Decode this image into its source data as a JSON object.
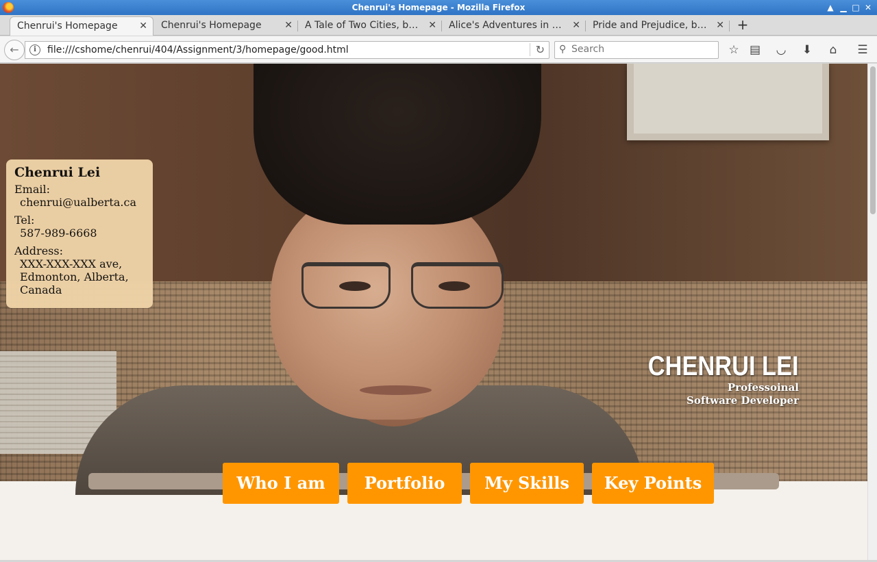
{
  "window": {
    "title": "Chenrui's Homepage - Mozilla Firefox"
  },
  "tabs": [
    {
      "label": "Chenrui's Homepage"
    },
    {
      "label": "Chenrui's Homepage"
    },
    {
      "label": "A Tale of Two Cities, by ..."
    },
    {
      "label": "Alice's Adventures in W..."
    },
    {
      "label": "Pride and Prejudice, by J..."
    }
  ],
  "navbar": {
    "url": "file:///cshome/chenrui/404/Assignment/3/homepage/good.html",
    "search_placeholder": "Search"
  },
  "page": {
    "contact": {
      "name": "Chenrui Lei",
      "email_label": "Email:",
      "email": "chenrui@ualberta.ca",
      "tel_label": "Tel:",
      "tel": "587-989-6668",
      "address_label": "Address:",
      "address_line1": "XXX-XXX-XXX ave,",
      "address_line2": "Edmonton, Alberta,",
      "address_line3": "Canada"
    },
    "hero": {
      "name": "CHENRUI LEI",
      "subtitle": "Professoinal Software Developer"
    },
    "nav": [
      {
        "label": "Who I am"
      },
      {
        "label": "Portfolio"
      },
      {
        "label": "My Skills"
      },
      {
        "label": "Key Points"
      }
    ]
  },
  "colors": {
    "accent": "#ff9600",
    "card": "#f0d4a8",
    "strip": "#ab9b8c",
    "page_bg": "#f4f1ec"
  }
}
